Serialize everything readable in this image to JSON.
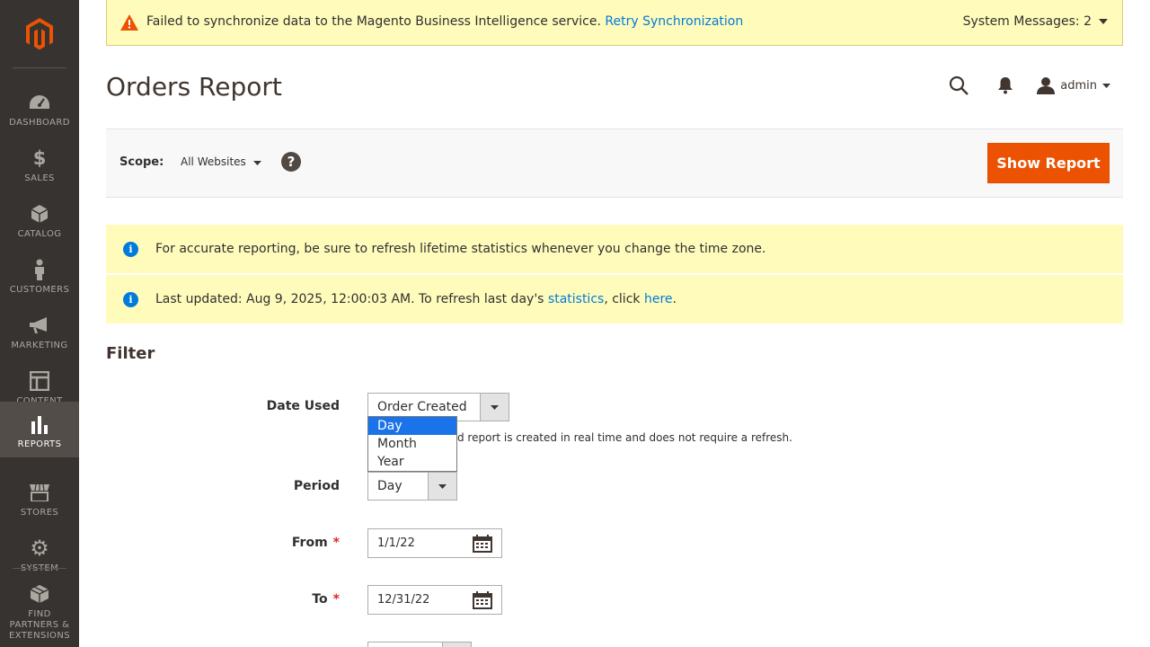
{
  "sidebar": {
    "items": [
      {
        "label": "DASHBOARD",
        "icon": "dashboard-icon"
      },
      {
        "label": "SALES",
        "icon": "dollar-icon"
      },
      {
        "label": "CATALOG",
        "icon": "cube-icon"
      },
      {
        "label": "CUSTOMERS",
        "icon": "person-icon"
      },
      {
        "label": "MARKETING",
        "icon": "megaphone-icon"
      },
      {
        "label": "CONTENT",
        "icon": "layout-icon"
      },
      {
        "label": "REPORTS",
        "icon": "bar-chart-icon"
      },
      {
        "label": "STORES",
        "icon": "store-icon"
      },
      {
        "label": "SYSTEM",
        "icon": "gear-icon"
      },
      {
        "label": "FIND PARTNERS & EXTENSIONS",
        "icon": "boxes-icon"
      }
    ],
    "active": "REPORTS"
  },
  "system_message": {
    "text": "Failed to synchronize data to the Magento Business Intelligence service.",
    "link": "Retry Synchronization",
    "count_label": "System Messages: 2"
  },
  "header": {
    "title": "Orders Report",
    "user": "admin"
  },
  "scope": {
    "label": "Scope:",
    "value": "All Websites",
    "button": "Show Report"
  },
  "notices": {
    "timezone": "For accurate reporting, be sure to refresh lifetime statistics whenever you change the time zone.",
    "updated_prefix": "Last updated: Aug 9, 2025, 12:00:03 AM. To refresh last day's ",
    "updated_link1": "statistics",
    "updated_mid": ", click ",
    "updated_link2": "here",
    "updated_suffix": "."
  },
  "filter": {
    "title": "Filter",
    "date_used_label": "Date Used",
    "date_used_value": "Order Created",
    "date_used_note": "d report is created in real time and does not require a refresh.",
    "period_label": "Period",
    "period_value": "Day",
    "period_options": [
      "Day",
      "Month",
      "Year"
    ],
    "period_highlighted": "Day",
    "from_label": "From",
    "from_value": "1/1/22",
    "to_label": "To",
    "to_value": "12/31/22"
  },
  "colors": {
    "sidebar_bg": "#373330",
    "accent": "#eb5202",
    "link": "#007bdb",
    "notice_bg": "#fffbbb"
  }
}
